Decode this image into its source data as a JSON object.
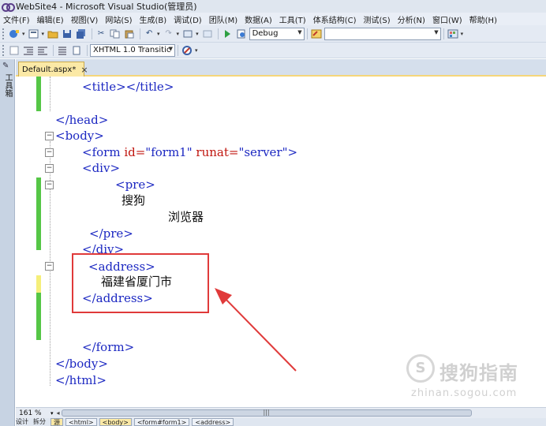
{
  "window": {
    "title": "WebSite4 - Microsoft Visual Studio(管理员)"
  },
  "menu": [
    "文件(F)",
    "编辑(E)",
    "视图(V)",
    "网站(S)",
    "生成(B)",
    "调试(D)",
    "团队(M)",
    "数据(A)",
    "工具(T)",
    "体系结构(C)",
    "测试(S)",
    "分析(N)",
    "窗口(W)",
    "帮助(H)"
  ],
  "toolbar": {
    "config_value": "Debug",
    "search_value": "",
    "doctype_value": "XHTML 1.0 Transitic"
  },
  "toolbox": {
    "label": "工具箱"
  },
  "tab": {
    "name": "Default.aspx*",
    "close": "×"
  },
  "code": {
    "l1_tag": "<title></title>",
    "l2_tag": "</head>",
    "l3_tag": "<body>",
    "l4_tag_open": "<form",
    "l4_attr1": " id=",
    "l4_val1": "\"form1\"",
    "l4_attr2": " runat=",
    "l4_val2": "\"server\"",
    "l4_tag_close": ">",
    "l5_tag": "<div>",
    "l6_tag": "<pre>",
    "l7_text": "搜狗",
    "l8_text": "浏览器",
    "l9_tag": "</pre>",
    "l10_tag": "</div>",
    "l11_tag": "<address>",
    "l12_text": "福建省厦门市",
    "l13_tag": "</address>",
    "l14_tag": "</form>",
    "l15_tag": "</body>",
    "l16_tag": "</html>"
  },
  "watermark": {
    "logo": "S",
    "text": "搜狗指南",
    "url": "zhinan.sogou.com"
  },
  "zoom": {
    "value": "161 %"
  },
  "viewbar": {
    "design": "设计",
    "split": "拆分",
    "source": "源",
    "crumbs": [
      "<html>",
      "<body>",
      "<form#form1>",
      "<address>"
    ]
  }
}
